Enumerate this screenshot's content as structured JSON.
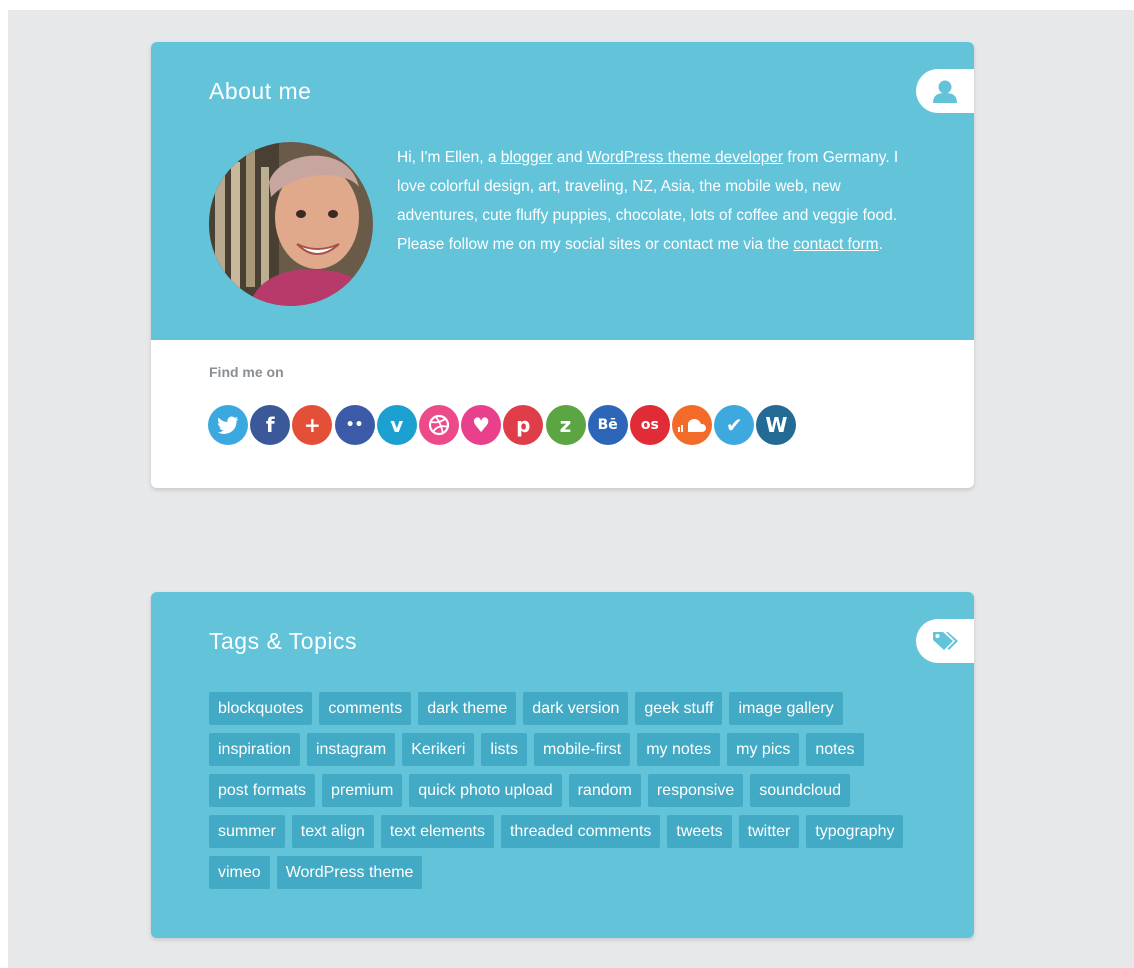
{
  "about": {
    "title": "About me",
    "bio": {
      "t1": "Hi, I'm Ellen, a ",
      "l1": "blogger",
      "t2": " and ",
      "l2": "WordPress theme developer",
      "t3": " from Germany. I love colorful design, art, traveling, NZ, Asia, the mobile web, new adventures, cute fluffy puppies, chocolate, lots of coffee and veggie food. Please follow me on my social sites or contact me via the ",
      "l3": "contact form",
      "t4": "."
    },
    "find_label": "Find me on",
    "socials": [
      {
        "name": "twitter-icon",
        "glyph": "",
        "color": "#3ba9e0"
      },
      {
        "name": "facebook-icon",
        "glyph": "f",
        "color": "#3b5998"
      },
      {
        "name": "googleplus-icon",
        "glyph": "+",
        "color": "#e34f37"
      },
      {
        "name": "flickr-icon",
        "glyph": "••",
        "color": "#3b5ba8"
      },
      {
        "name": "vimeo-icon",
        "glyph": "v",
        "color": "#1ba0d0"
      },
      {
        "name": "dribbble-icon",
        "glyph": "",
        "color": "#ec4a89"
      },
      {
        "name": "heart-icon",
        "glyph": "♥",
        "color": "#e8408a"
      },
      {
        "name": "pinterest-icon",
        "glyph": "p",
        "color": "#e03d4b"
      },
      {
        "name": "zerply-icon",
        "glyph": "z",
        "color": "#5ba542"
      },
      {
        "name": "behance-icon",
        "glyph": "Bē",
        "color": "#2d66b9"
      },
      {
        "name": "lastfm-icon",
        "glyph": "os",
        "color": "#e12b37"
      },
      {
        "name": "soundcloud-icon",
        "glyph": "",
        "color": "#f26b28"
      },
      {
        "name": "foursquare-icon",
        "glyph": "✔",
        "color": "#3ea9de"
      },
      {
        "name": "wordpress-icon",
        "glyph": "W",
        "color": "#236b94"
      }
    ]
  },
  "tags": {
    "title": "Tags & Topics",
    "items": [
      "blockquotes",
      "comments",
      "dark theme",
      "dark version",
      "geek stuff",
      "image gallery",
      "inspiration",
      "instagram",
      "Kerikeri",
      "lists",
      "mobile-first",
      "my notes",
      "my pics",
      "notes",
      "post formats",
      "premium",
      "quick photo upload",
      "random",
      "responsive",
      "soundcloud",
      "summer",
      "text align",
      "text elements",
      "threaded comments",
      "tweets",
      "twitter",
      "typography",
      "vimeo",
      "WordPress theme"
    ]
  },
  "colors": {
    "accent": "#63c3d9",
    "tag_bg": "#43aac5",
    "page_bg": "#e6e8ea"
  }
}
